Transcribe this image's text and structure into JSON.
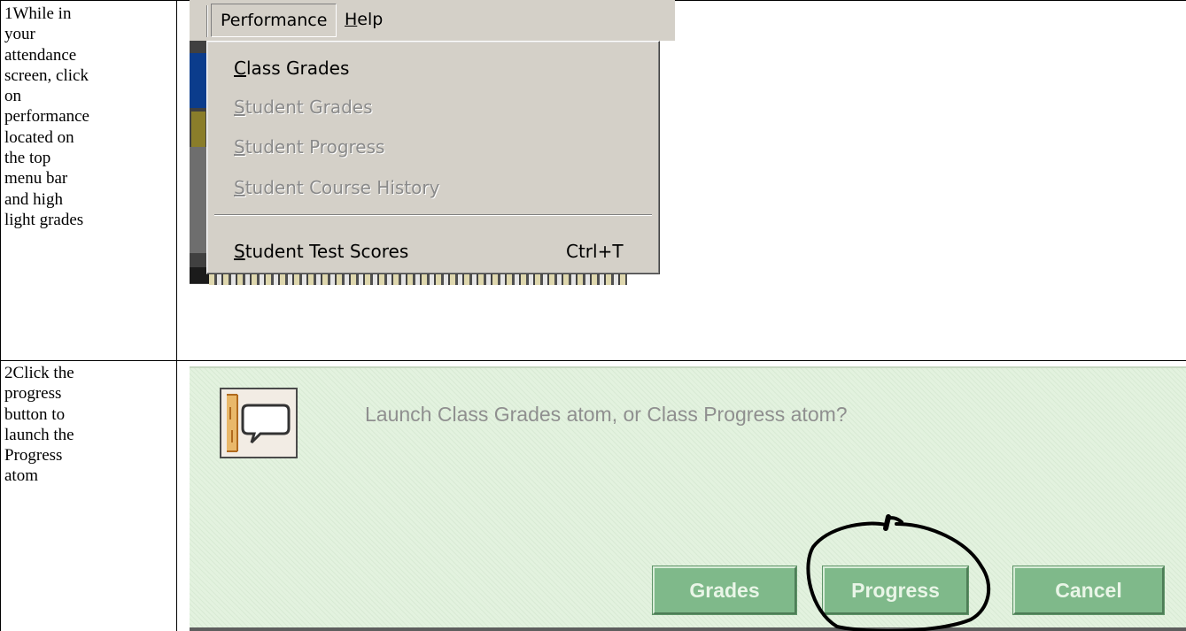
{
  "rows": [
    {
      "step_text": "1While in\nyour\nattendance\nscreen, click\non\nperformance\nlocated on\nthe top\nmenu bar\nand high\nlight grades"
    },
    {
      "step_text": "2Click the\nprogress\nbutton to\nlaunch the\nProgress\natom"
    }
  ],
  "menu": {
    "bar": {
      "performance": "Performance",
      "help_rest": "elp",
      "help_key": "H"
    },
    "items": [
      {
        "key": "C",
        "rest": "lass Grades",
        "enabled": true
      },
      {
        "key": "S",
        "rest": "tudent Grades",
        "enabled": false
      },
      {
        "key": "S",
        "rest": "tudent Progress",
        "enabled": false
      },
      {
        "key": "S",
        "rest": "tudent Course History",
        "enabled": false
      }
    ],
    "test_scores": {
      "key": "S",
      "rest": "tudent Test Scores",
      "shortcut": "Ctrl+T"
    }
  },
  "dialog": {
    "message": "Launch Class Grades atom, or Class Progress atom?",
    "buttons": {
      "grades": "Grades",
      "progress": "Progress",
      "cancel": "Cancel"
    },
    "button_color": "#7fb98a",
    "background_color": "#e3f2df",
    "icon": "speech-bubble-icon"
  },
  "annotation": {
    "circled_button": "Progress",
    "ink_color": "#000000"
  }
}
